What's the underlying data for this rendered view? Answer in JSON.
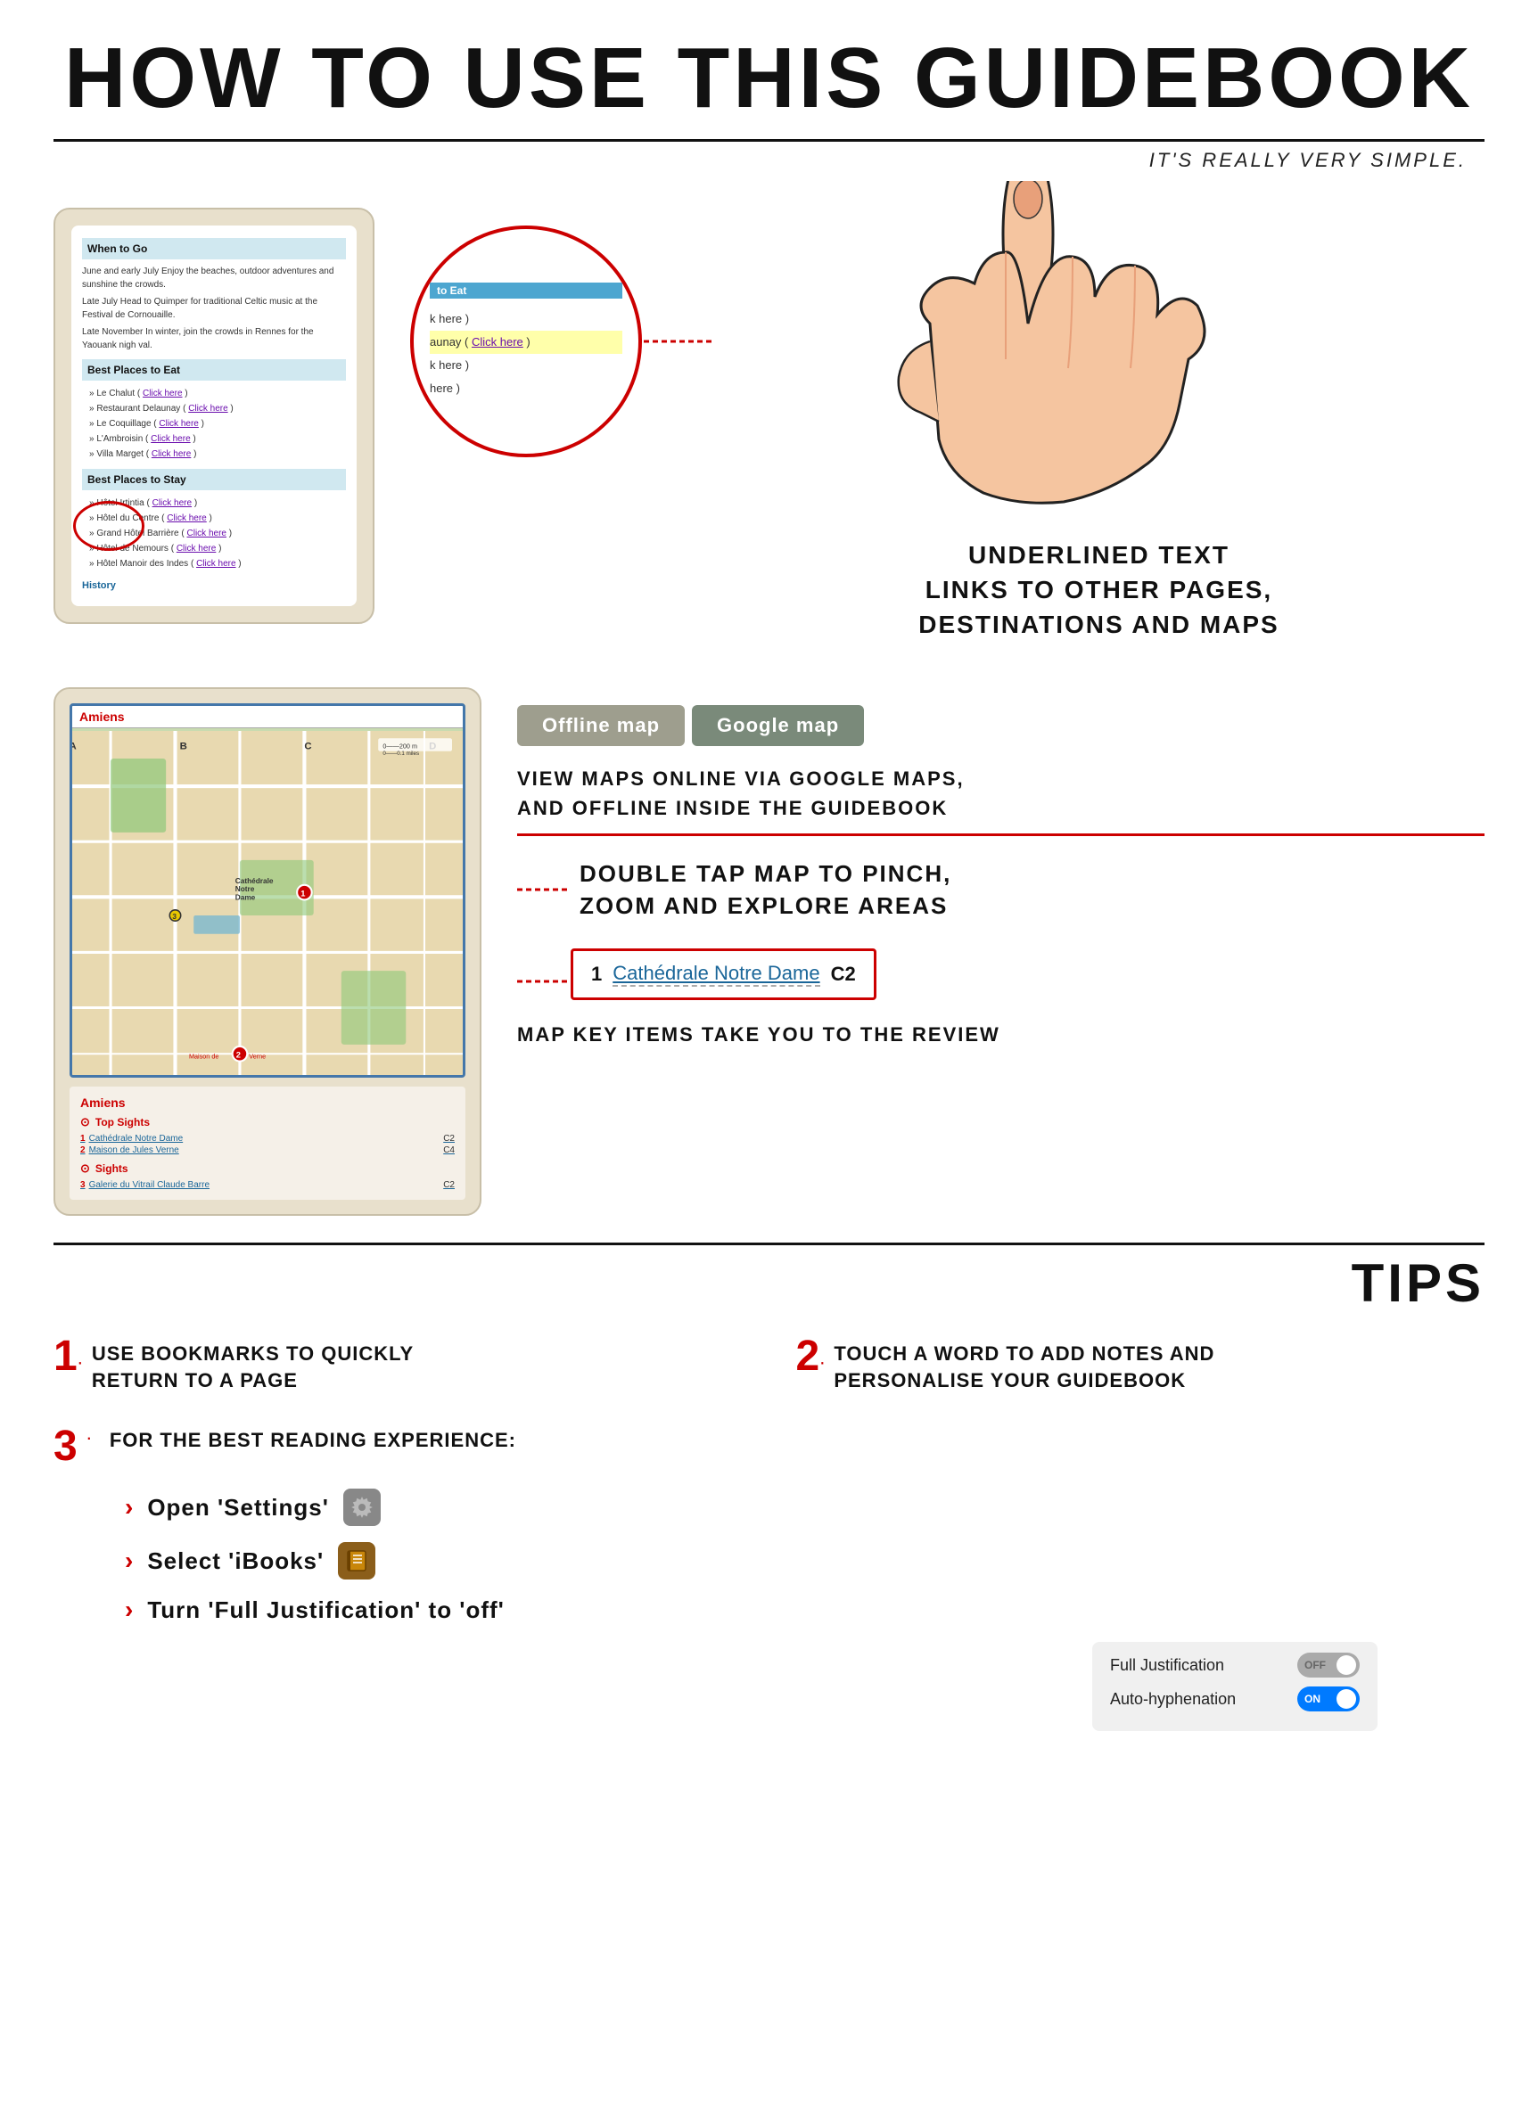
{
  "header": {
    "title": "HOW TO USE THIS GUIDEBOOK",
    "subtitle": "IT'S REALLY VERY SIMPLE."
  },
  "section1": {
    "guidebook": {
      "when_to_go": "When to Go",
      "when_text1": "June and early July Enjoy the beaches, outdoor adventures and sunshine the crowds.",
      "when_text2": "Late July Head to Quimper for traditional Celtic music at the Festival de Cornouaille.",
      "when_text3": "Late November In winter, join the crowds in Rennes for the Yaouank night val.",
      "best_eat": "Best Places to Eat",
      "eat_items": [
        {
          "name": "Le Chalut",
          "link": "Click here"
        },
        {
          "name": "Restaurant Delaunay",
          "link": "Click here"
        },
        {
          "name": "Le Coquillage",
          "link": "Click here"
        },
        {
          "name": "L'Ambroisin",
          "link": "Click here"
        },
        {
          "name": "Villa Marget",
          "link": "Click here"
        }
      ],
      "best_stay": "Best Places to Stay",
      "stay_items": [
        {
          "name": "Hôtel Irtintia",
          "link": "Click here"
        },
        {
          "name": "Hôtel du Centre",
          "link": "Click here"
        },
        {
          "name": "Grand Hôtel Barrière",
          "link": "Click here"
        },
        {
          "name": "Hôtel de Nemours",
          "link": "Click here"
        },
        {
          "name": "Hôtel Manoir des Indes",
          "link": "Click here"
        }
      ],
      "history": "History"
    },
    "zoom": {
      "bar_text": "to Eat",
      "lines": [
        {
          "text": "k here )",
          "link": false
        },
        {
          "text": "aunay ( Click here )",
          "link": true,
          "link_text": "Click here"
        },
        {
          "text": "k here )",
          "link": false
        },
        {
          "text": "here )",
          "link": false
        }
      ]
    },
    "desc": {
      "line1": "UNDERLINED TEXT",
      "line2": "LINKS TO OTHER PAGES,",
      "line3": "DESTINATIONS AND MAPS"
    }
  },
  "section2": {
    "map": {
      "city": "Amiens",
      "city2": "Amiens"
    },
    "buttons": {
      "offline": "Offline map",
      "google": "Google map"
    },
    "desc1": {
      "line1": "VIEW MAPS ONLINE VIA GOOGLE MAPS,",
      "line2": "AND OFFLINE INSIDE THE GUIDEBOOK"
    },
    "desc2": {
      "line1": "DOUBLE TAP MAP TO PINCH,",
      "line2": "ZOOM AND EXPLORE AREAS"
    },
    "key_item": {
      "number": "1",
      "label": "Cathédrale Notre Dame",
      "coord": "C2"
    },
    "key_desc": "MAP KEY ITEMS TAKE YOU TO THE REVIEW",
    "legend": {
      "top_sights_label": "Top Sights",
      "top_sights": [
        {
          "num": "1",
          "name": "Cathédrale Notre Dame",
          "coord": "C2"
        },
        {
          "num": "2",
          "name": "Maison de Jules Verne",
          "coord": "C4"
        }
      ],
      "sights_label": "Sights",
      "sights": [
        {
          "num": "3",
          "name": "Galerie du Vitrail Claude Barre",
          "coord": "C2"
        }
      ]
    }
  },
  "tips": {
    "title": "TIPS",
    "items": [
      {
        "number": "1",
        "text": "USE BOOKMARKS TO QUICKLY\nRETURN TO A PAGE"
      },
      {
        "number": "2",
        "text": "TOUCH A WORD TO ADD NOTES AND\nPERSONALISE YOUR GUIDEBOOK"
      }
    ],
    "tip3": {
      "number": "3",
      "intro": "FOR THE BEST READING EXPERIENCE:",
      "rows": [
        {
          "text": "Open 'Settings'",
          "icon": "settings"
        },
        {
          "text": "Select 'iBooks'",
          "icon": "ibooks"
        },
        {
          "text": "Turn 'Full Justification' to 'off'",
          "icon": null
        }
      ]
    },
    "settings_panel": {
      "rows": [
        {
          "label": "Full Justification",
          "state": "OFF"
        },
        {
          "label": "Auto-hyphenation",
          "state": "ON"
        }
      ]
    }
  }
}
